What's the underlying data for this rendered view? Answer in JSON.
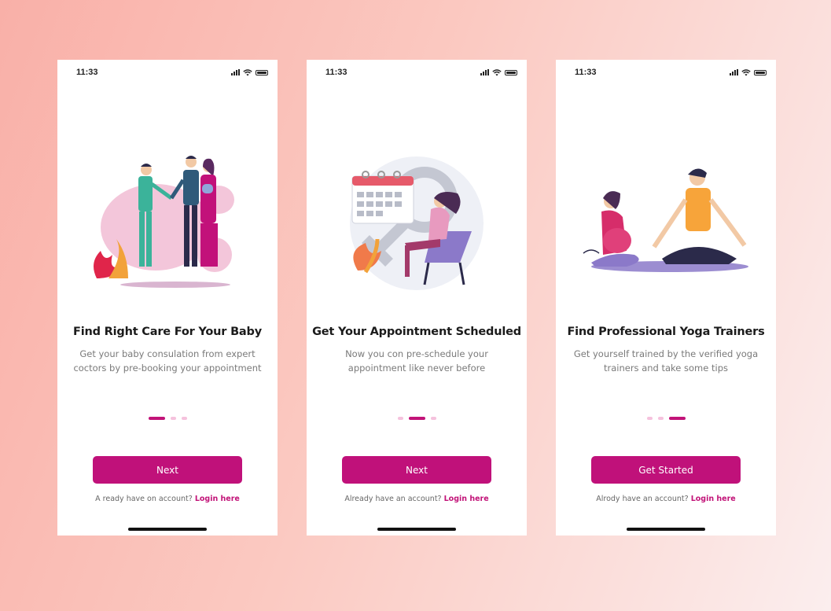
{
  "screens": [
    {
      "time": "11:33",
      "title": "Find  Right Care For Your Baby",
      "description_line1": "Get your baby consulation from expert",
      "description_line2": "coctors by pre-booking your appointment",
      "active_dot": 0,
      "button_label": "Next",
      "login_prompt": "A ready have on account?",
      "login_link": "Login here"
    },
    {
      "time": "11:33",
      "title": "Get Your Appointment Scheduled",
      "description_line1": "Now you con pre-schedule your",
      "description_line2": "appointment like never before",
      "active_dot": 1,
      "button_label": "Next",
      "login_prompt": "Already have an account?",
      "login_link": "Login here"
    },
    {
      "time": "11:33",
      "title": "Find Professional Yoga Trainers",
      "description_line1": "Get yourself trained by the verified yoga",
      "description_line2": "trainers and take some tips",
      "active_dot": 2,
      "button_label": "Get Started",
      "login_prompt": "Alrody have an account?",
      "login_link": "Login here"
    }
  ],
  "colors": {
    "accent": "#c0117a",
    "dot_inactive": "#f5c2dd",
    "title": "#1b1b1b",
    "body_text": "#7a7a7a"
  },
  "icons": [
    "signal-icon",
    "wifi-icon",
    "battery-icon"
  ]
}
